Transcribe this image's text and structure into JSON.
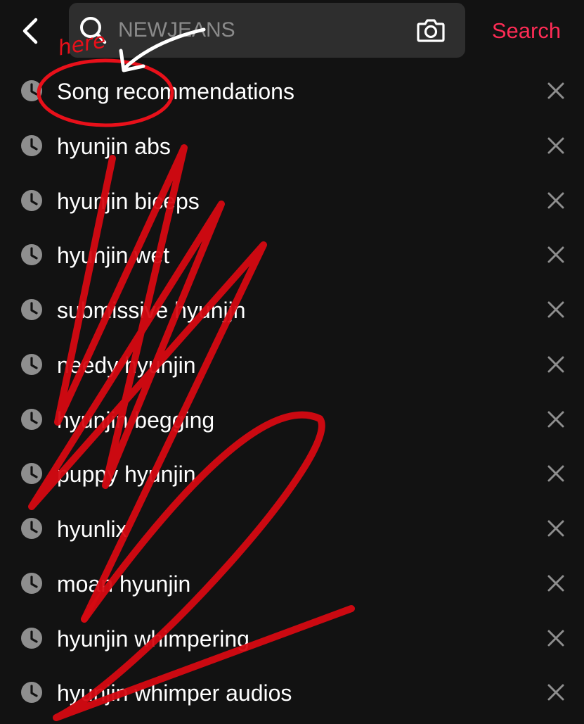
{
  "header": {
    "search_placeholder": "NEWJEANS",
    "search_button_label": "Search"
  },
  "history": [
    {
      "label": "Song recommendations"
    },
    {
      "label": "hyunjin abs"
    },
    {
      "label": "hyunjin biceps"
    },
    {
      "label": "hyunjin wet"
    },
    {
      "label": "submissive hyunjjn"
    },
    {
      "label": "needy hyunjin"
    },
    {
      "label": "hyunjin begging"
    },
    {
      "label": "puppy hyunjin"
    },
    {
      "label": "hyunlix"
    },
    {
      "label": "moan hyunjin"
    },
    {
      "label": "hyunjin whimpering"
    },
    {
      "label": "hyunjin whimper audios"
    }
  ],
  "annotation": {
    "label": "here",
    "color": "#e8101a"
  },
  "colors": {
    "accent": "#fe2c55",
    "background": "#121212",
    "search_box": "#2e2e2e",
    "icon_gray": "#8e8e8e"
  },
  "icons": {
    "back": "chevron-left-icon",
    "search": "magnifier-icon",
    "camera": "camera-icon",
    "history": "clock-icon",
    "remove": "close-icon"
  }
}
